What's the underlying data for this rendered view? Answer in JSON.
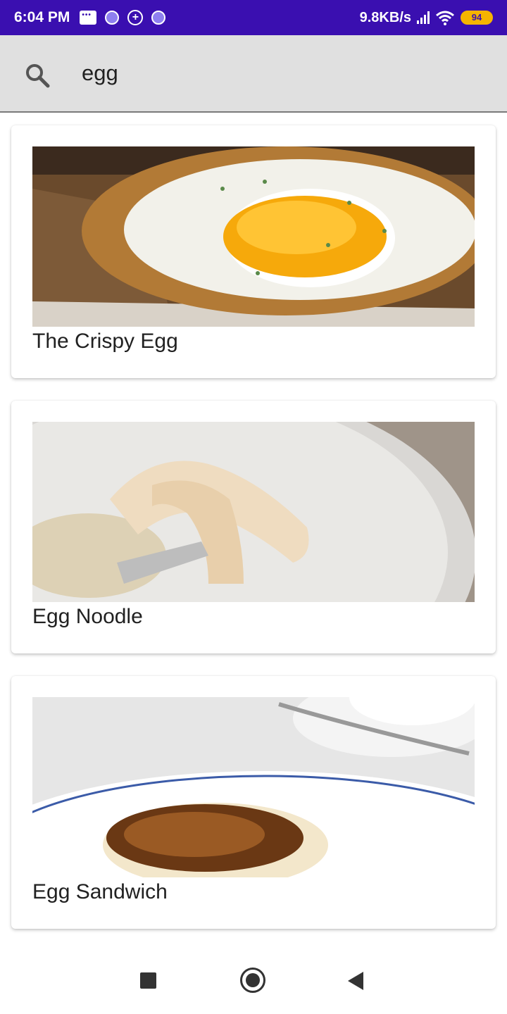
{
  "status_bar": {
    "time": "6:04 PM",
    "network_speed": "9.8KB/s",
    "battery": "94"
  },
  "search": {
    "query": "egg"
  },
  "results": [
    {
      "title": "The Crispy Egg",
      "image": "fried-egg-on-toast"
    },
    {
      "title": "Egg Noodle",
      "image": "egg-noodles-on-plate"
    },
    {
      "title": "Egg Sandwich",
      "image": "egg-muffin-on-plate"
    }
  ],
  "colors": {
    "status_bar_bg": "#3a0fb0",
    "search_bar_bg": "#e0e0e0",
    "battery": "#f5b400"
  }
}
